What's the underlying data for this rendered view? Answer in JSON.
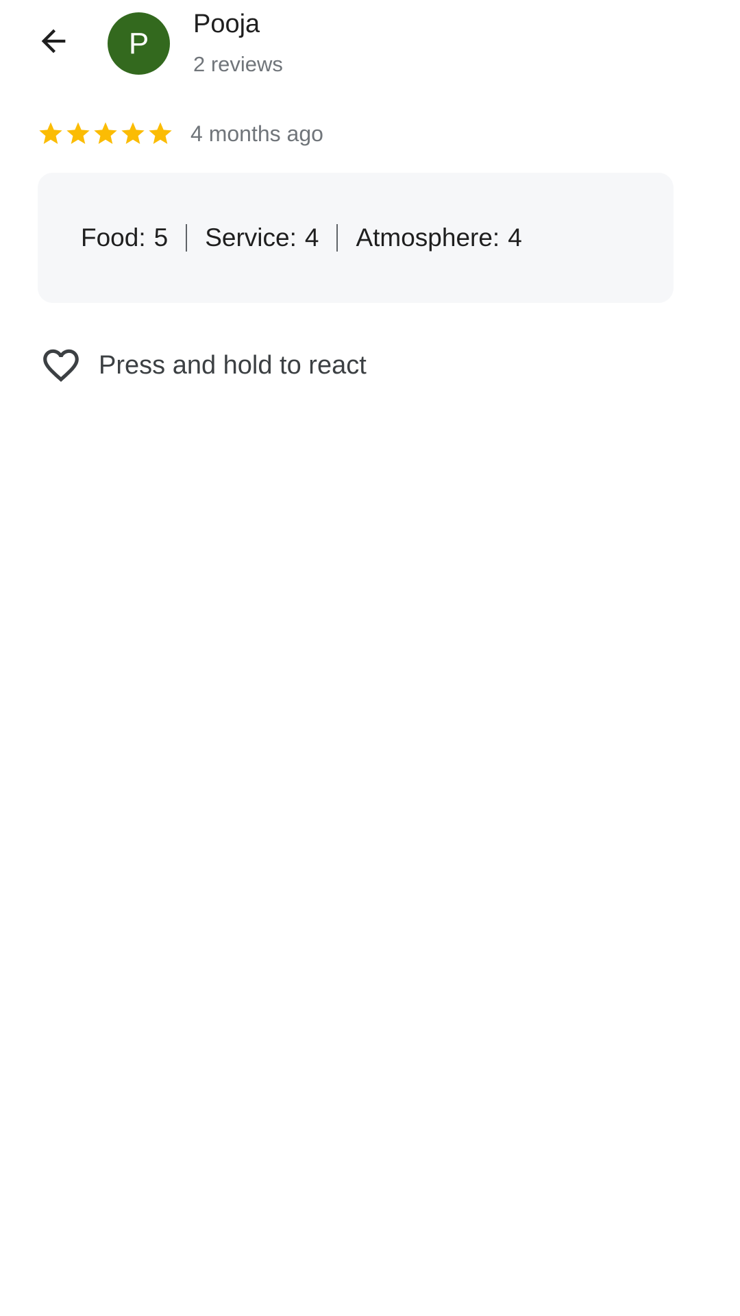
{
  "header": {
    "author_name": "Pooja",
    "avatar_letter": "P",
    "review_count": "2 reviews",
    "avatar_color": "#33691e",
    "back_icon": "arrow-back-icon"
  },
  "review": {
    "stars": 5,
    "star_max": 5,
    "star_color": "#fbbc04",
    "time_ago": "4 months ago"
  },
  "ratings": [
    {
      "label": "Food:",
      "value": "5"
    },
    {
      "label": "Service:",
      "value": "4"
    },
    {
      "label": "Atmosphere:",
      "value": "4"
    }
  ],
  "react": {
    "icon": "heart-outline-icon",
    "label": "Press and hold to react"
  }
}
